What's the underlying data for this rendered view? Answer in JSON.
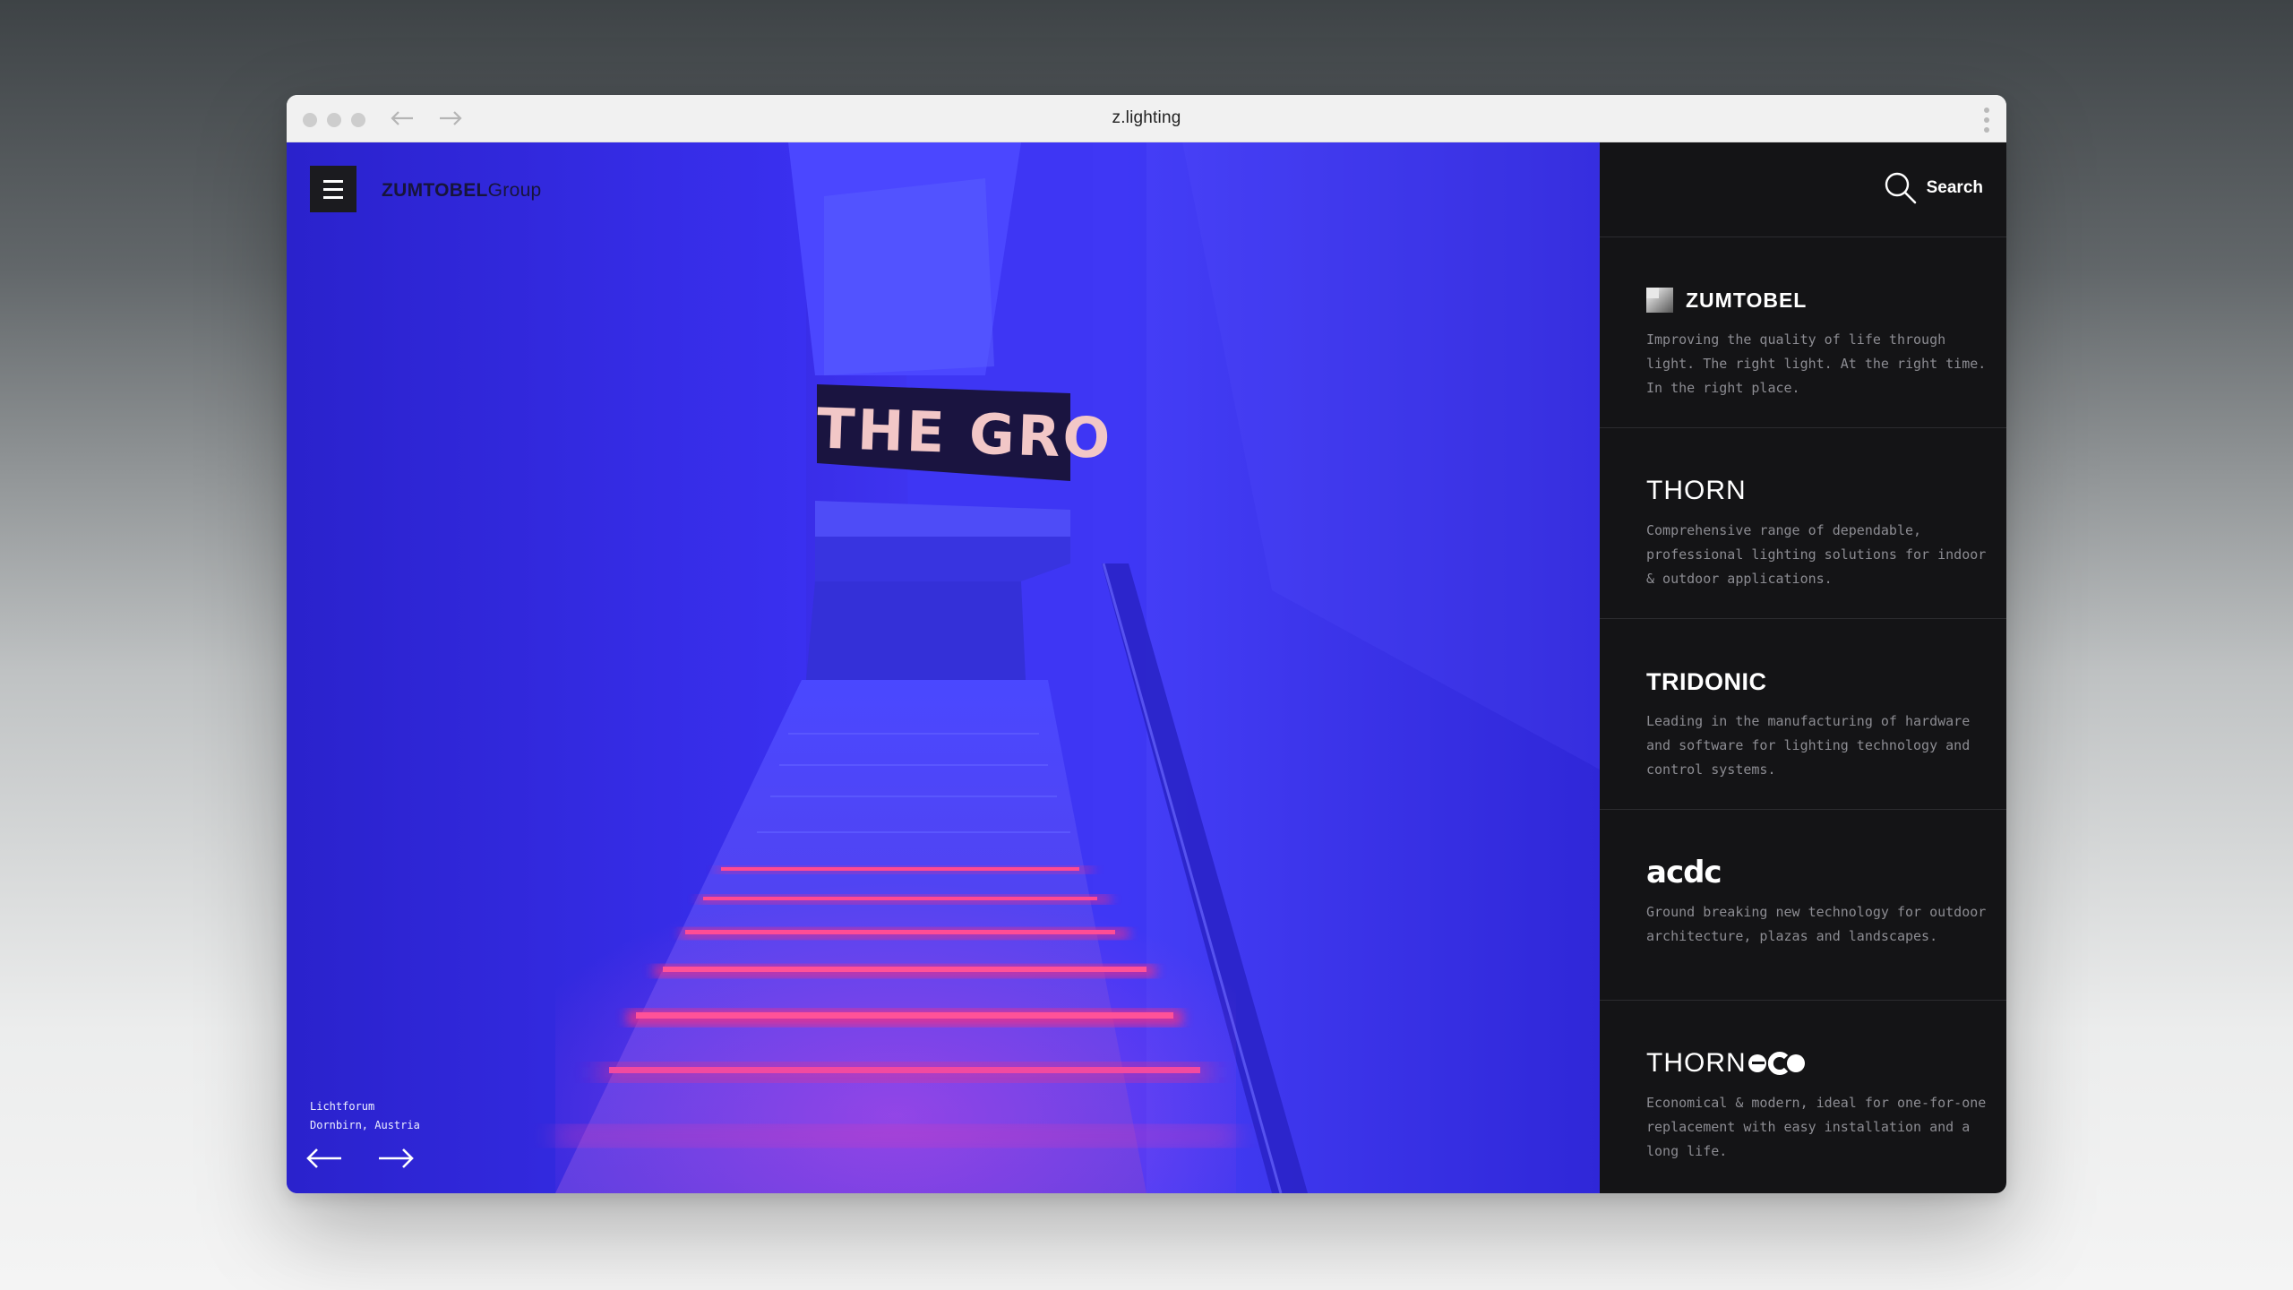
{
  "browser": {
    "title": "z.lighting",
    "back_icon": "arrow-left-icon",
    "forward_icon": "arrow-right-icon",
    "menu_icon": "kebab-menu-icon"
  },
  "header": {
    "brand_bold": "ZUMTOBEL",
    "brand_light": "Group",
    "menu_icon": "hamburger-icon"
  },
  "hero": {
    "sign_text": "THE GRO",
    "caption_line1": "Lichtforum",
    "caption_line2": "Dornbirn, Austria",
    "prev_icon": "arrow-left-icon",
    "next_icon": "arrow-right-icon"
  },
  "search": {
    "label": "Search",
    "icon": "search-icon"
  },
  "brands": [
    {
      "name": "ZUMTOBEL",
      "description": "Improving the quality of life through light. The right light. At the right time. In the right place."
    },
    {
      "name": "THORN",
      "description": "Comprehensive range of dependable, professional lighting solutions for indoor & outdoor applications."
    },
    {
      "name": "TRIDONIC",
      "description": "Leading in the manufacturing of hardware and software for lighting technology and control systems."
    },
    {
      "name": "acdc",
      "description": "Ground breaking new technology for outdoor architecture, plazas and landscapes."
    },
    {
      "name": "THORN",
      "name_suffix": "eco",
      "description": "Economical & modern, ideal for one-for-one replacement with easy installation and a long life."
    }
  ],
  "colors": {
    "hero_blue": "#3a30ea",
    "panel_bg": "#141416",
    "step_glow": "#ff2f7a"
  }
}
